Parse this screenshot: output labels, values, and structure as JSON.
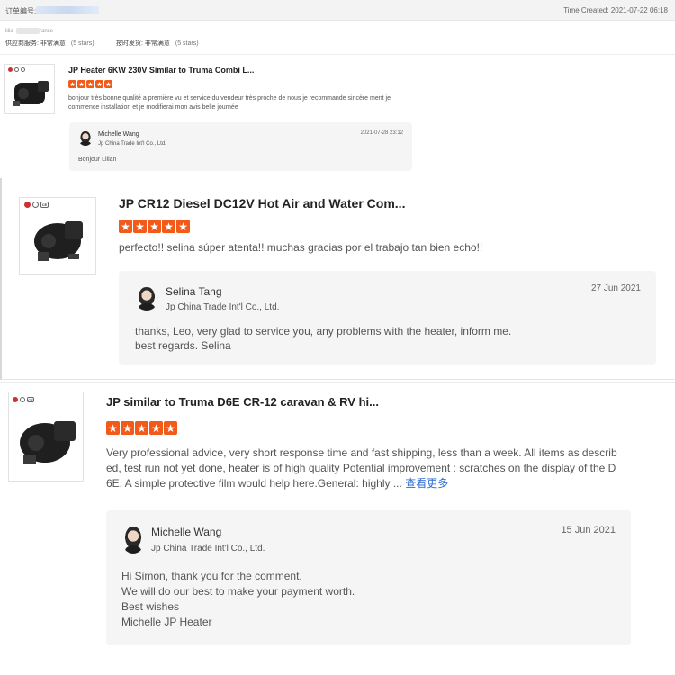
{
  "order": {
    "label": "订单编号:",
    "time_created": "Time Created: 2021-07-22 06:18"
  },
  "buyer": {
    "name_prefix": "lilia",
    "name_suffix": "rance"
  },
  "ratings": [
    {
      "label": "供应商服务: 非常满意",
      "stars": "(5 stars)"
    },
    {
      "label": "按时发货: 非常满意",
      "stars": "(5 stars)"
    }
  ],
  "reviews": [
    {
      "product_title": "JP Heater 6KW 230V Similar to Truma Combi L...",
      "rating": 5,
      "text": "bonjour très bonne qualité a première vu et service du vendeur très proche de nous je recommande sincère ment je commence installation et je modifierai mon avis  belle journée",
      "reply": {
        "name": "Michelle Wang",
        "company": "Jp China Trade Int'l Co., Ltd.",
        "date": "2021-07-28 23:12",
        "text": "Bonjour Lilian"
      }
    },
    {
      "product_title": "JP CR12 Diesel DC12V Hot Air and Water Com...",
      "rating": 5,
      "text": "perfecto!! selina súper atenta!! muchas gracias por el trabajo tan bien echo!!",
      "reply": {
        "name": "Selina Tang",
        "company": "Jp China Trade Int'l Co., Ltd.",
        "date": "27 Jun 2021",
        "text_lines": [
          "thanks, Leo, very glad to service you, any problems with the heater, inform me.",
          "best regards. Selina"
        ]
      }
    },
    {
      "product_title": "JP similar to Truma D6E CR-12 caravan & RV hi...",
      "rating": 5,
      "text_lines": [
        "Very professional advice, very short response time and fast shipping, less than a week. All items as describ",
        "ed, test run not yet done, heater is of high quality  Potential improvement : scratches on the display of the D",
        "6E. A simple protective film would help here.General: highly ..."
      ],
      "more_label": "查看更多",
      "reply": {
        "name": "Michelle Wang",
        "company": "Jp China Trade Int'l Co., Ltd.",
        "date": "15 Jun 2021",
        "text_lines": [
          "Hi Simon, thank you for the comment.",
          "We will do our best to make your payment worth.",
          "Best wishes",
          "Michelle JP Heater"
        ]
      }
    }
  ],
  "icons": {
    "certification": "certification-marks-icon",
    "star": "star-icon"
  },
  "colors": {
    "star": "#f25a1a",
    "more_link": "#2b6cd3"
  }
}
